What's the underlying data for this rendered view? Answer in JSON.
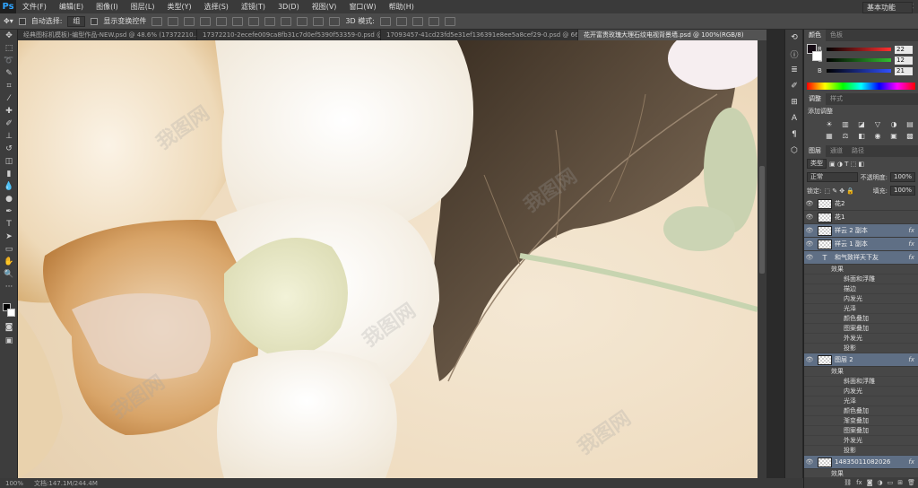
{
  "app": {
    "logo": "Ps"
  },
  "menu": [
    "文件(F)",
    "编辑(E)",
    "图像(I)",
    "图层(L)",
    "类型(Y)",
    "选择(S)",
    "滤镜(T)",
    "3D(D)",
    "视图(V)",
    "窗口(W)",
    "帮助(H)"
  ],
  "window_controls": [
    "—",
    "□",
    "✕"
  ],
  "options": {
    "auto_select_label": "自动选择:",
    "auto_select_value": "组",
    "show_transform_label": "显示变换控件",
    "mode_3d_label": "3D 模式:",
    "workspace": "基本功能"
  },
  "tabs": [
    "经典图标机模板)-编型作品-NEW.psd @ 48.6% (17372210...",
    "17372210-2ecefe009ca8fb31c7d0ef5390f53359-0.psd @ 66.7% (图...",
    "17093457-41cd23fd5e31ef136391e8ee5a8cef29-0.psd @ 66.7%...",
    "花开富贵玫瑰大理石纹电视背景墙.psd @ 100%(RGB/8)"
  ],
  "statusbar": {
    "zoom": "100%",
    "doc": "文档:147.1M/244.4M"
  },
  "color_panel": {
    "tabs": [
      "颜色",
      "色板"
    ],
    "channels": [
      {
        "label": "R",
        "value": "22",
        "color": "#ff3030"
      },
      {
        "label": "G",
        "value": "12",
        "color": "#30c030"
      },
      {
        "label": "B",
        "value": "21",
        "color": "#3050ff"
      }
    ]
  },
  "adjust_panel": {
    "tabs": [
      "调整",
      "样式"
    ],
    "title": "添加调整",
    "icons": [
      "☀",
      "▥",
      "◪",
      "▽",
      "◑",
      "▤",
      "▦",
      "⚖",
      "◧",
      "◉",
      "▣",
      "▩"
    ]
  },
  "layers_panel": {
    "tabs": [
      "图层",
      "通道",
      "路径"
    ],
    "filter": "类型",
    "blend_mode": "正常",
    "opacity_label": "不透明度:",
    "opacity": "100%",
    "lock_label": "锁定:",
    "fill_label": "填充:",
    "fill": "100%",
    "layers": [
      {
        "name": "花2",
        "selected": false,
        "fx": false
      },
      {
        "name": "花1",
        "selected": false,
        "fx": false
      },
      {
        "name": "祥云 2 副本",
        "selected": true,
        "fx": true
      },
      {
        "name": "祥云 1 副本",
        "selected": true,
        "fx": true
      },
      {
        "name": "和气致祥天下友",
        "selected": true,
        "fx": true,
        "text": true
      }
    ],
    "effects_1": {
      "label": "效果",
      "items": [
        "斜面和浮雕",
        "描边",
        "内发光",
        "光泽",
        "颜色叠加",
        "图案叠加",
        "外发光",
        "投影"
      ]
    },
    "layer_2": {
      "name": "图层 2"
    },
    "effects_2": {
      "label": "效果",
      "items": [
        "斜面和浮雕",
        "内发光",
        "光泽",
        "颜色叠加",
        "渐变叠加",
        "图案叠加",
        "外发光",
        "投影"
      ]
    },
    "layer_last": {
      "name": "14835011082026",
      "label2": "效果"
    }
  },
  "watermark": "我图网"
}
